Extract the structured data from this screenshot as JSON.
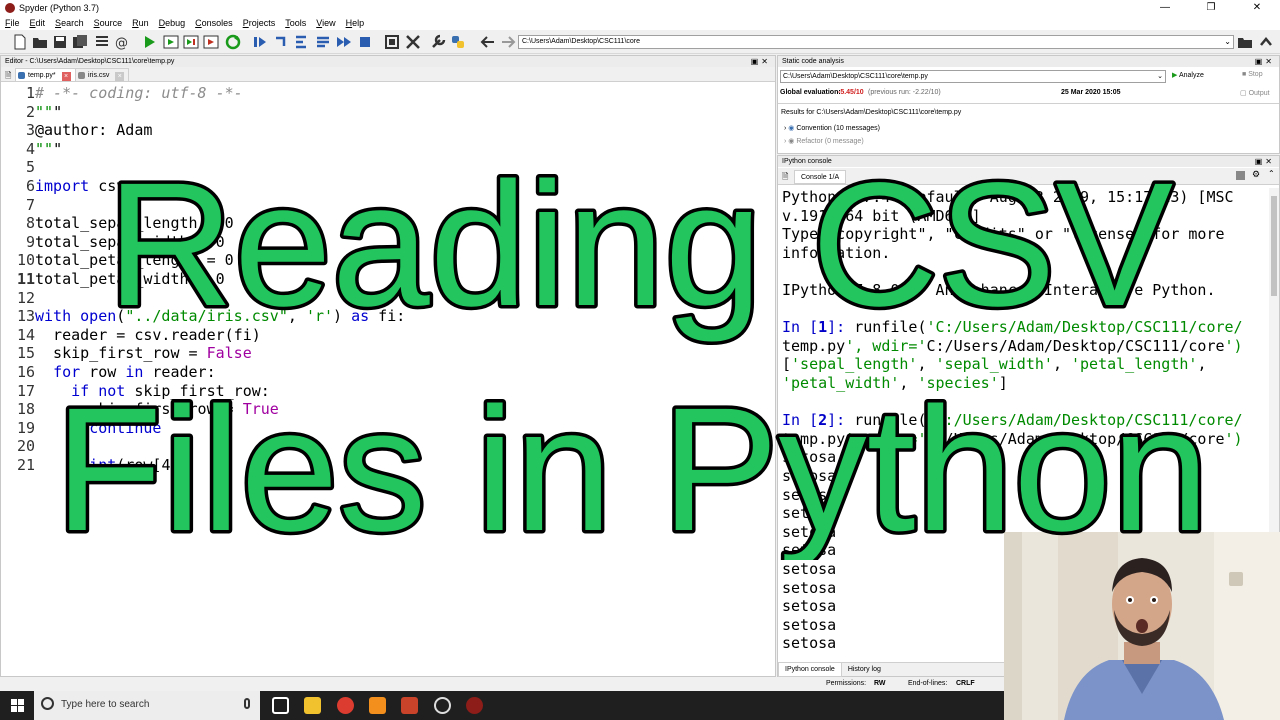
{
  "window": {
    "title": "Spyder (Python 3.7)"
  },
  "menu": [
    "File",
    "Edit",
    "Search",
    "Source",
    "Run",
    "Debug",
    "Consoles",
    "Projects",
    "Tools",
    "View",
    "Help"
  ],
  "toolbar": {
    "path": "C:\\Users\\Adam\\Desktop\\CSC111\\core"
  },
  "editor": {
    "title": "Editor - C:\\Users\\Adam\\Desktop\\CSC111\\core\\temp.py",
    "tabs": [
      {
        "label": "temp.py*",
        "active": true
      },
      {
        "label": "iris.csv",
        "active": false
      }
    ],
    "current_line": 11,
    "lines": [
      "# -*- coding: utf-8 -*-",
      "\"\"\"",
      "@author: Adam",
      "\"\"\"",
      "",
      "import csv",
      "",
      "total_sepal_length = 0",
      "total_sepal_width = 0",
      "total_petal_length = 0",
      "total_petal_width = 0",
      "",
      "with open(\"../data/iris.csv\", 'r') as fi:",
      "  reader = csv.reader(fi)",
      "  skip_first_row = False",
      "  for row in reader:",
      "    if not skip_first_row:",
      "      skip_first_row = True",
      "      continue",
      "",
      "    print(row[4])"
    ]
  },
  "static_analysis": {
    "title": "Static code analysis",
    "file": "C:\\Users\\Adam\\Desktop\\CSC111\\core\\temp.py",
    "analyze_label": "Analyze",
    "stop_label": "Stop",
    "output_label": "Output",
    "global_eval_label": "Global evaluation:",
    "global_eval_score": "-5.45/10",
    "previous_run": "(previous run: -2.22/10)",
    "date": "25 Mar 2020 15:05",
    "results_for": "Results for C:\\Users\\Adam\\Desktop\\CSC111\\core\\temp.py",
    "items": [
      "Convention (10 messages)",
      "Refactor (0 message)"
    ]
  },
  "ipython": {
    "title": "IPython console",
    "tab": "Console 1/A",
    "bottom_tabs": [
      "IPython console",
      "History log"
    ],
    "lines": [
      "Python 3.7.4 (default, Aug 13 2019, 15:17:13) [MSC",
      "v.1915 64 bit (AMD64)]",
      "Type \"copyright\", \"credits\" or \"license\" for more",
      "information.",
      "",
      "IPython 7.8.0 -- An enhanced Interactive Python.",
      "",
      "In [1]: runfile('C:/Users/Adam/Desktop/CSC111/core/",
      "temp.py', wdir='C:/Users/Adam/Desktop/CSC111/core')",
      "['sepal_length', 'sepal_width', 'petal_length',",
      "'petal_width', 'species']",
      "",
      "In [2]: runfile('C:/Users/Adam/Desktop/CSC111/core/",
      "temp.py', wdir='C:/Users/Adam/Desktop/CSC111/core')",
      "setosa",
      "setosa",
      "setosa",
      "setosa",
      "setosa",
      "setosa",
      "setosa",
      "setosa",
      "setosa",
      "setosa",
      "setosa"
    ]
  },
  "statusbar": {
    "permissions_label": "Permissions:",
    "permissions": "RW",
    "eol_label": "End-of-lines:",
    "eol": "CRLF"
  },
  "taskbar": {
    "search_placeholder": "Type here to search"
  },
  "overlay": {
    "line1": "Reading CSV",
    "line2": "Files in Python",
    "fill_color": "#22c55e",
    "stroke_color": "#000000"
  }
}
